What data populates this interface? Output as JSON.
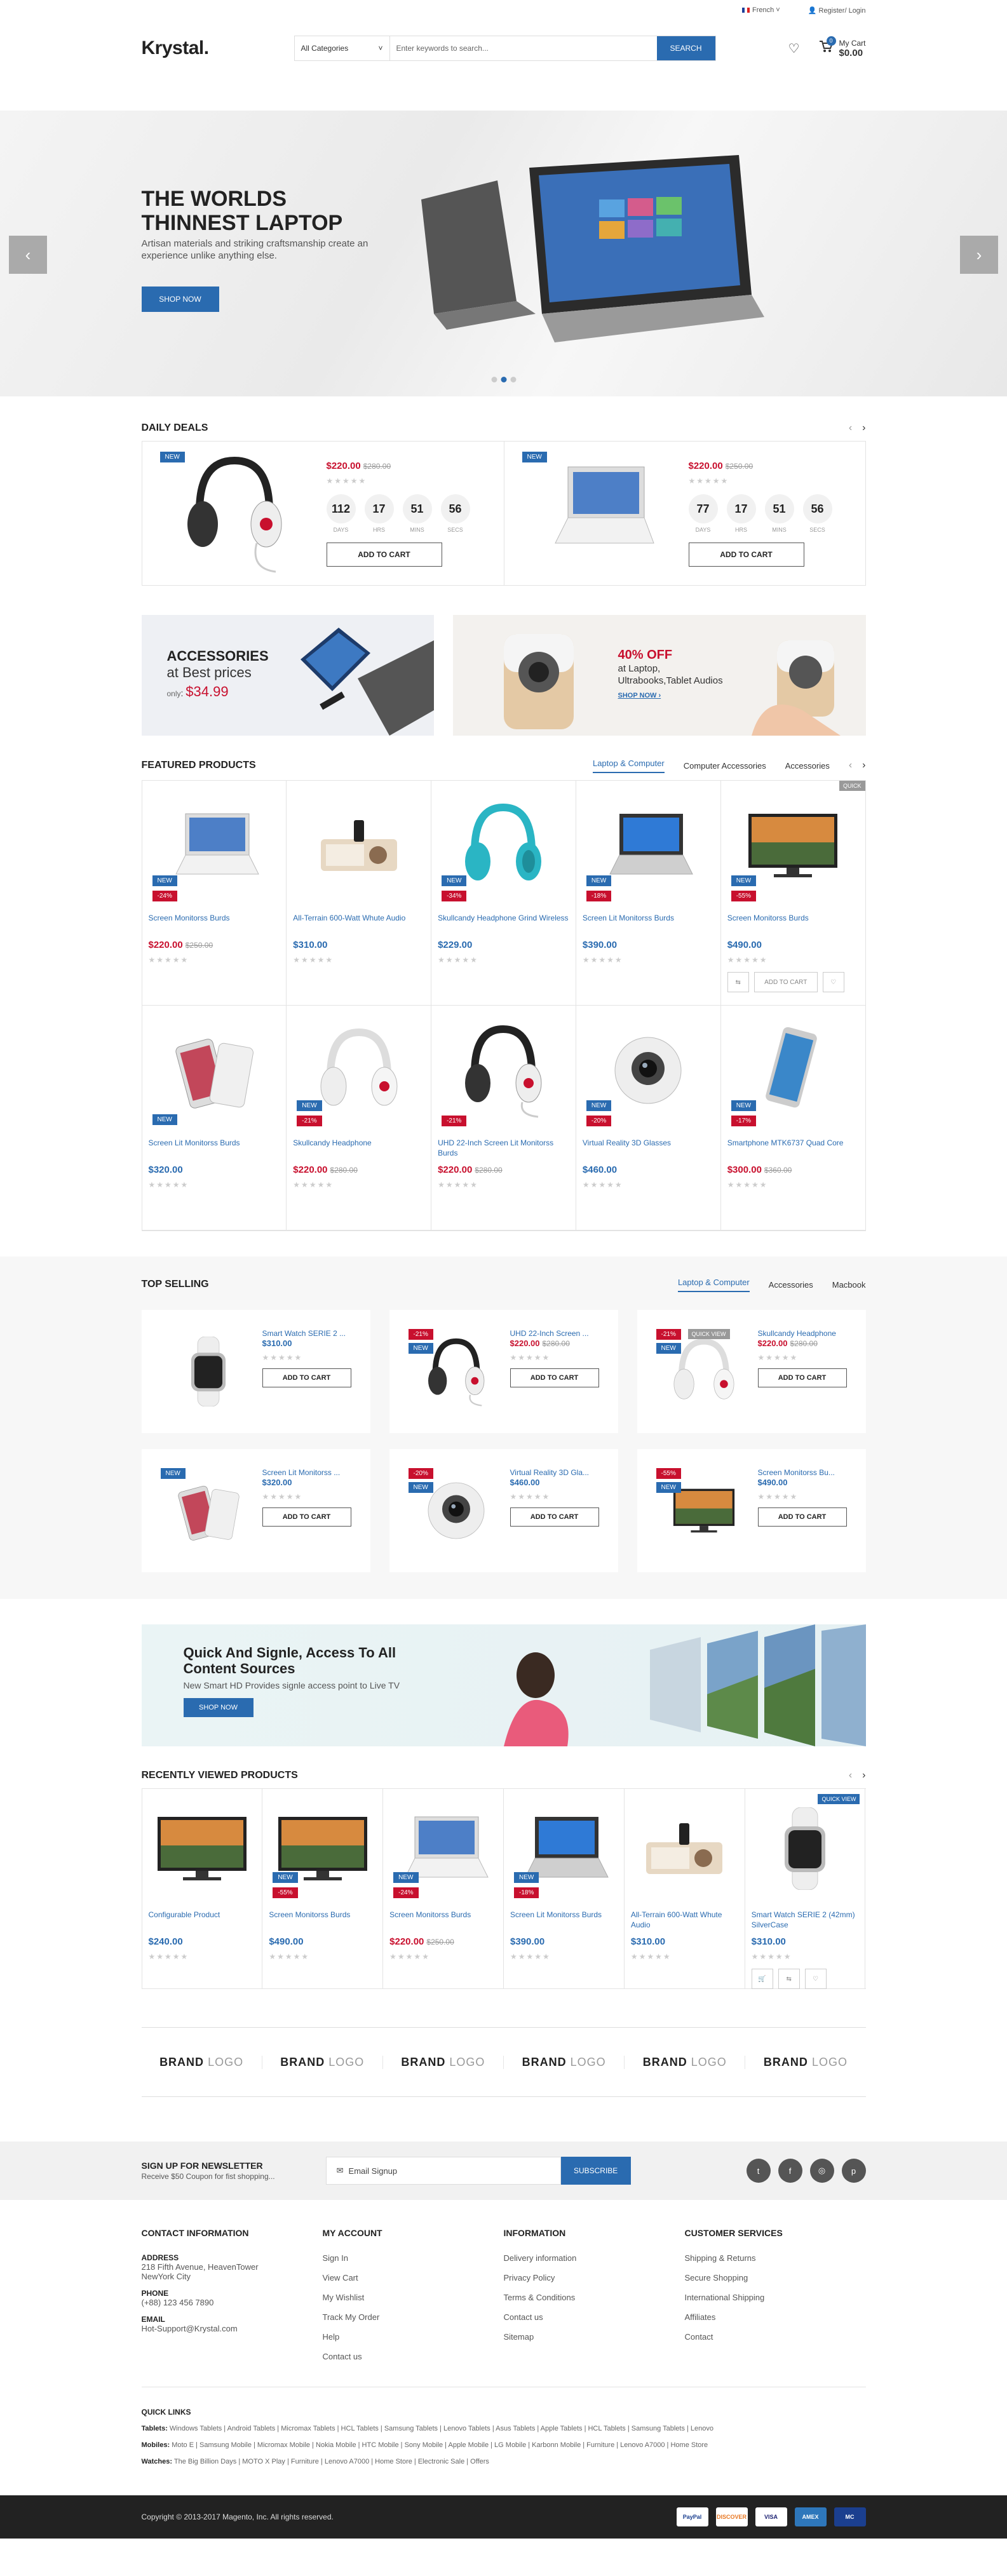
{
  "topbar": {
    "language": "French",
    "account": "Register/ Login"
  },
  "header": {
    "logo": "Krystal.",
    "category": "All Categories",
    "search_placeholder": "Enter keywords to search...",
    "search_button": "SEARCH",
    "cart_label": "My Cart",
    "cart_total": "$0.00",
    "cart_count": "0"
  },
  "hero": {
    "title": "THE WORLDS THINNEST LAPTOP",
    "text": "Artisan materials and striking craftsmanship create an experience unlike anything else.",
    "button": "SHOP NOW",
    "prev": "‹",
    "next": "›"
  },
  "deals": {
    "title": "DAILY DEALS",
    "items": [
      {
        "new": "NEW",
        "price": "$220.00",
        "old": "$280.00",
        "days": "112",
        "hrs": "17",
        "mins": "51",
        "secs": "56",
        "button": "ADD TO CART"
      },
      {
        "new": "NEW",
        "price": "$220.00",
        "old": "$250.00",
        "days": "77",
        "hrs": "17",
        "mins": "51",
        "secs": "56",
        "button": "ADD TO CART"
      }
    ],
    "labels": {
      "days": "DAYS",
      "hrs": "HRS",
      "mins": "MINS",
      "secs": "SECS"
    }
  },
  "banners": {
    "b1_title": "ACCESSORIES",
    "b1_sub": "at Best prices",
    "b1_only": "only",
    "b1_price": "$34.99",
    "b2_off": "40% OFF",
    "b2_text": "at Laptop, Ultrabooks,Tablet Audios",
    "b2_link": "SHOP NOW ›"
  },
  "featured": {
    "title": "FEATURED PRODUCTS",
    "tabs": [
      "Laptop & Computer",
      "Computer Accessories",
      "Accessories"
    ],
    "products": [
      {
        "name": "Screen Monitorss Burds",
        "price": "$220.00",
        "old": "$250.00",
        "new": "NEW",
        "off": "-24%",
        "img": "laptop-white"
      },
      {
        "name": "All-Terrain 600-Watt Whute Audio",
        "price": "$310.00",
        "old": "",
        "new": "",
        "off": "",
        "img": "dock"
      },
      {
        "name": "Skullcandy Headphone Grind Wireless",
        "price": "$229.00",
        "old": "",
        "new": "NEW",
        "off": "-34%",
        "img": "headphone-teal"
      },
      {
        "name": "Screen Lit Monitorss Burds",
        "price": "$390.00",
        "old": "",
        "new": "NEW",
        "off": "-18%",
        "img": "laptop-silver"
      },
      {
        "name": "Screen Monitorss Burds",
        "price": "$490.00",
        "old": "",
        "new": "NEW",
        "off": "-55%",
        "img": "tv"
      },
      {
        "name": "Screen Lit Monitorss Burds",
        "price": "$320.00",
        "old": "",
        "new": "NEW",
        "off": "",
        "img": "phone"
      },
      {
        "name": "Skullcandy Headphone",
        "price": "$220.00",
        "old": "$280.00",
        "new": "NEW",
        "off": "-21%",
        "img": "headphone-white"
      },
      {
        "name": "UHD 22-Inch Screen Lit Monitorss Burds",
        "price": "$220.00",
        "old": "$280.00",
        "new": "",
        "off": "-21%",
        "img": "headphone-black"
      },
      {
        "name": "Virtual Reality 3D Glasses",
        "price": "$460.00",
        "old": "",
        "new": "NEW",
        "off": "-20%",
        "img": "camera"
      },
      {
        "name": "Smartphone MTK6737 Quad Core",
        "price": "$300.00",
        "old": "$360.00",
        "new": "NEW",
        "off": "-17%",
        "img": "phone-blue"
      }
    ],
    "quick": "QUICK",
    "add_to_cart": "ADD TO CART"
  },
  "topselling": {
    "title": "TOP SELLING",
    "tabs": [
      "Laptop & Computer",
      "Accessories",
      "Macbook"
    ],
    "items": [
      {
        "name": "Smart Watch SERIE 2 ...",
        "price": "$310.00",
        "old": "",
        "new": "",
        "off": "",
        "img": "watch"
      },
      {
        "name": "UHD 22-Inch Screen ...",
        "price": "$220.00",
        "old": "$280.00",
        "new": "NEW",
        "off": "-21%",
        "img": "headphone-black"
      },
      {
        "name": "Skullcandy Headphone",
        "price": "$220.00",
        "old": "$280.00",
        "new": "NEW",
        "off": "-21%",
        "img": "headphone-white"
      },
      {
        "name": "Screen Lit Monitorss ...",
        "price": "$320.00",
        "old": "",
        "new": "NEW",
        "off": "",
        "img": "phone"
      },
      {
        "name": "Virtual Reality 3D Gla...",
        "price": "$460.00",
        "old": "",
        "new": "NEW",
        "off": "-20%",
        "img": "camera"
      },
      {
        "name": "Screen Monitorss Bu...",
        "price": "$490.00",
        "old": "",
        "new": "NEW",
        "off": "-55%",
        "img": "tv"
      }
    ],
    "quick_view": "QUICK VIEW",
    "add_to_cart": "ADD TO CART"
  },
  "tvbanner": {
    "title": "Quick And Signle, Access To All Content Sources",
    "text": "New Smart HD Provides signle access point to Live TV",
    "button": "SHOP NOW"
  },
  "recent": {
    "title": "RECENTLY VIEWED PRODUCTS",
    "items": [
      {
        "name": "Configurable Product",
        "price": "$240.00",
        "old": "",
        "new": "",
        "off": "",
        "img": "tv"
      },
      {
        "name": "Screen Monitorss Burds",
        "price": "$490.00",
        "old": "",
        "new": "NEW",
        "off": "-55%",
        "img": "tv"
      },
      {
        "name": "Screen Monitorss Burds",
        "price": "$220.00",
        "old": "$250.00",
        "new": "NEW",
        "off": "-24%",
        "img": "laptop-white"
      },
      {
        "name": "Screen Lit Monitorss Burds",
        "price": "$390.00",
        "old": "",
        "new": "NEW",
        "off": "-18%",
        "img": "laptop-silver"
      },
      {
        "name": "All-Terrain 600-Watt Whute Audio",
        "price": "$310.00",
        "old": "",
        "new": "",
        "off": "",
        "img": "dock"
      },
      {
        "name": "Smart Watch SERIE 2 (42mm) SilverCase",
        "price": "$310.00",
        "old": "",
        "new": "",
        "off": "",
        "img": "watch"
      }
    ],
    "quick_view": "QUICK VIEW"
  },
  "brands": {
    "bold": "BRAND",
    "light": "LOGO",
    "count": 6
  },
  "newsletter": {
    "title": "SIGN UP FOR NEWSLETTER",
    "sub": "Receive $50 Coupon for fist shopping...",
    "placeholder": "Email Signup",
    "button": "SUBSCRIBE"
  },
  "footer": {
    "contact_title": "CONTACT INFORMATION",
    "address_label": "ADDRESS",
    "address": "218 Fifth Avenue, HeavenTower NewYork City",
    "phone_label": "PHONE",
    "phone": "(+88) 123 456 7890",
    "email_label": "EMAIL",
    "email": "Hot-Support@Krystal.com",
    "account_title": "MY ACCOUNT",
    "account": [
      "Sign In",
      "View Cart",
      "My Wishlist",
      "Track My Order",
      "Help",
      "Contact us"
    ],
    "info_title": "INFORMATION",
    "info": [
      "Delivery information",
      "Privacy Policy",
      "Terms & Conditions",
      "Contact us",
      "Sitemap"
    ],
    "service_title": "CUSTOMER SERVICES",
    "service": [
      "Shipping & Returns",
      "Secure Shopping",
      "International Shipping",
      "Affiliates",
      "Contact"
    ],
    "quick_title": "QUICK LINKS",
    "tablets_label": "Tablets:",
    "tablets": "Windows Tablets | Android Tablets | Micromax Tablets | HCL Tablets | Samsung Tablets | Lenovo Tablets | Asus Tablets | Apple Tablets | HCL Tablets | Samsung Tablets | Lenovo",
    "mobiles_label": "Mobiles:",
    "mobiles": "Moto E | Samsung Mobile | Micromax Mobile | Nokia Mobile | HTC Mobile | Sony Mobile | Apple Mobile | LG Mobile | Karbonn Mobile | Furniture | Lenovo A7000 | Home Store",
    "watches_label": "Watches:",
    "watches": "The Big Billion Days | MOTO X Play | Furniture | Lenovo A7000 | Home Store | Electronic Sale | Offers",
    "copyright": "Copyright © 2013-2017 Magento, Inc. All rights reserved.",
    "pay": [
      "PayPal",
      "DISCOVER",
      "VISA",
      "AMEX",
      "MC"
    ]
  },
  "colors": {
    "accent": "#2a6bb0",
    "sale": "#c8102e"
  }
}
